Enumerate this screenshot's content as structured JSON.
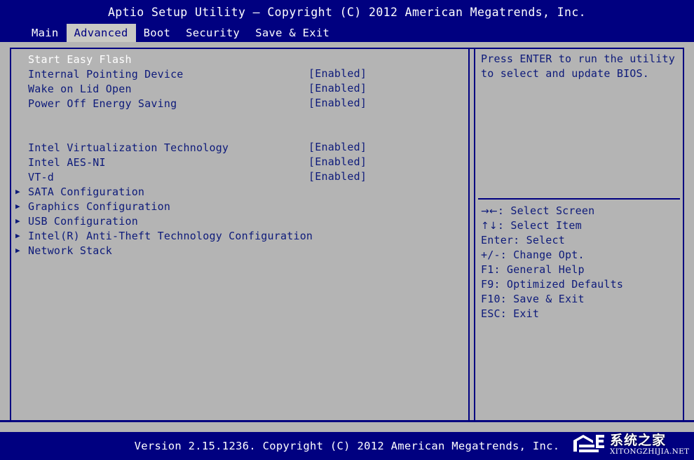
{
  "colors": {
    "screen_blue": "#000080",
    "panel_gray": "#b4b4b4",
    "text_blue": "#0d1a7a",
    "text_white": "#ffffff",
    "active_tab_bg": "#c9c9c4"
  },
  "titlebar": {
    "title": "Aptio Setup Utility – Copyright (C) 2012 American Megatrends, Inc."
  },
  "menubar": {
    "tabs": [
      {
        "label": "Main",
        "active": false
      },
      {
        "label": "Advanced",
        "active": true
      },
      {
        "label": "Boot",
        "active": false
      },
      {
        "label": "Security",
        "active": false
      },
      {
        "label": "Save & Exit",
        "active": false
      }
    ]
  },
  "settings": {
    "rows": [
      {
        "marker": "",
        "label": "Start Easy Flash",
        "value": "",
        "selected": true,
        "submenu": false
      },
      {
        "marker": "",
        "label": "Internal Pointing Device",
        "value": "[Enabled]",
        "selected": false,
        "submenu": false
      },
      {
        "marker": "",
        "label": "Wake on Lid Open",
        "value": "[Enabled]",
        "selected": false,
        "submenu": false
      },
      {
        "marker": "",
        "label": "Power Off Energy Saving",
        "value": "[Enabled]",
        "selected": false,
        "submenu": false
      },
      {
        "marker": "",
        "label": "",
        "value": "",
        "selected": false,
        "submenu": false
      },
      {
        "marker": "",
        "label": "",
        "value": "",
        "selected": false,
        "submenu": false
      },
      {
        "marker": "",
        "label": "Intel Virtualization Technology",
        "value": "[Enabled]",
        "selected": false,
        "submenu": false
      },
      {
        "marker": "",
        "label": "Intel AES-NI",
        "value": "[Enabled]",
        "selected": false,
        "submenu": false
      },
      {
        "marker": "",
        "label": "VT-d",
        "value": "[Enabled]",
        "selected": false,
        "submenu": false
      },
      {
        "marker": "▶",
        "label": "SATA Configuration",
        "value": "",
        "selected": false,
        "submenu": true
      },
      {
        "marker": "▶",
        "label": "Graphics Configuration",
        "value": "",
        "selected": false,
        "submenu": true
      },
      {
        "marker": "▶",
        "label": "USB Configuration",
        "value": "",
        "selected": false,
        "submenu": true
      },
      {
        "marker": "▶",
        "label": "Intel(R) Anti-Theft Technology Configuration",
        "value": "",
        "selected": false,
        "submenu": true
      },
      {
        "marker": "▶",
        "label": "Network Stack",
        "value": "",
        "selected": false,
        "submenu": true
      }
    ]
  },
  "help": {
    "lines": [
      "Press ENTER to run the utility",
      "to select and update BIOS."
    ]
  },
  "keys": {
    "lines": [
      {
        "glyph": "→←",
        "text": ": Select Screen"
      },
      {
        "glyph": "↑↓",
        "text": ": Select Item"
      },
      {
        "glyph": "",
        "text": "Enter: Select"
      },
      {
        "glyph": "",
        "text": "+/-: Change Opt."
      },
      {
        "glyph": "",
        "text": "F1: General Help"
      },
      {
        "glyph": "",
        "text": "F9: Optimized Defaults"
      },
      {
        "glyph": "",
        "text": "F10: Save & Exit"
      },
      {
        "glyph": "",
        "text": "ESC: Exit"
      }
    ]
  },
  "footer": {
    "version": "Version 2.15.1236. Copyright (C) 2012 American Megatrends, Inc."
  },
  "watermark": {
    "cn": "系统之家",
    "en": "XITONGZHIJIA.NET"
  }
}
